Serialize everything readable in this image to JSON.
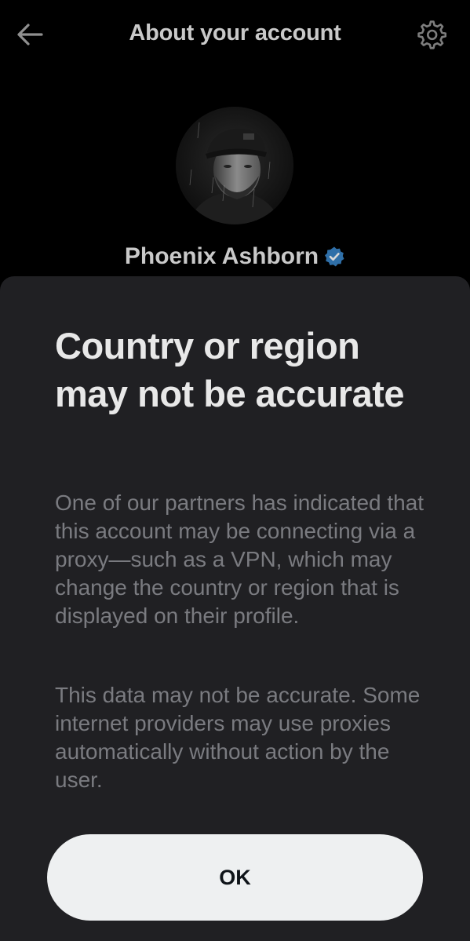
{
  "header": {
    "title": "About your account",
    "back_icon": "arrow-left-icon",
    "settings_icon": "gear-icon"
  },
  "profile": {
    "name": "Phoenix Ashborn",
    "verified_icon": "verified-badge-icon",
    "verified_color": "#1d9bf0"
  },
  "sheet": {
    "title": "Country or region may not be accurate",
    "paragraph_1": "One of our partners has indicated that this account may be connecting via a proxy—such as a VPN, which may change the country or region that is displayed on their profile.",
    "paragraph_2": "This data may not be accurate. Some internet providers may use proxies automatically without action by the user.",
    "ok_label": "OK"
  }
}
